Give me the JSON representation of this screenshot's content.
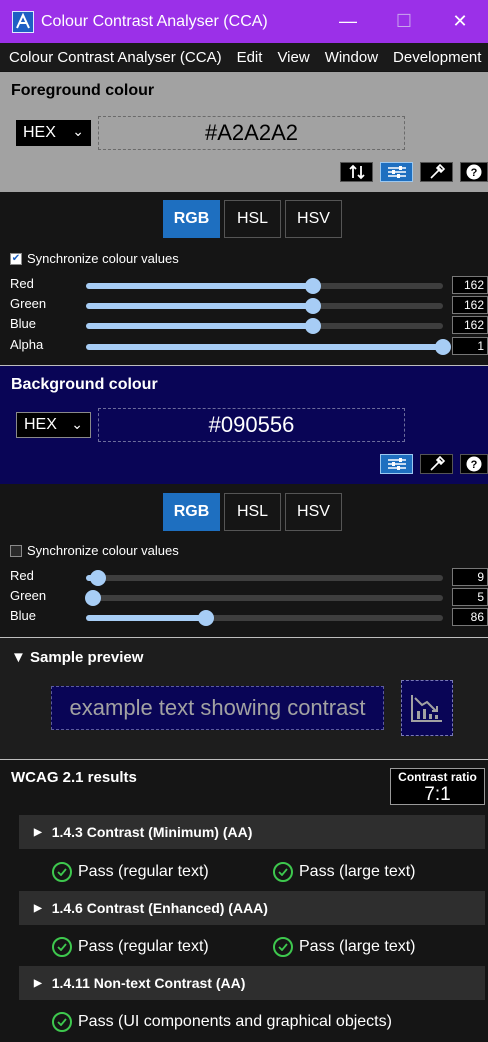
{
  "window": {
    "title": "Colour Contrast Analyser (CCA)",
    "minimize": "—",
    "maximize": "☐",
    "close": "✕"
  },
  "menu": [
    "Colour Contrast Analyser (CCA)",
    "Edit",
    "View",
    "Window",
    "Development"
  ],
  "foreground": {
    "heading": "Foreground colour",
    "format": "HEX",
    "value": "#A2A2A2",
    "colour": "#a2a2a2",
    "tools": [
      "swap-icon",
      "sliders-icon",
      "eyedropper-icon",
      "help-icon"
    ]
  },
  "fg_mode": {
    "tabs": [
      "RGB",
      "HSL",
      "HSV"
    ],
    "selected": "RGB",
    "sync_label": "Synchronize colour values",
    "sync_checked": true,
    "sliders": [
      {
        "label": "Red",
        "value": "162",
        "fraction": 0.635
      },
      {
        "label": "Green",
        "value": "162",
        "fraction": 0.635
      },
      {
        "label": "Blue",
        "value": "162",
        "fraction": 0.635
      },
      {
        "label": "Alpha",
        "value": "1",
        "fraction": 1.0
      }
    ]
  },
  "background": {
    "heading": "Background colour",
    "format": "HEX",
    "value": "#090556",
    "colour": "#090556",
    "tools": [
      "sliders-icon",
      "eyedropper-icon",
      "help-icon"
    ]
  },
  "bg_mode": {
    "tabs": [
      "RGB",
      "HSL",
      "HSV"
    ],
    "selected": "RGB",
    "sync_label": "Synchronize colour values",
    "sync_checked": false,
    "sliders": [
      {
        "label": "Red",
        "value": "9",
        "fraction": 0.035
      },
      {
        "label": "Green",
        "value": "5",
        "fraction": 0.02
      },
      {
        "label": "Blue",
        "value": "86",
        "fraction": 0.337
      }
    ]
  },
  "preview": {
    "heading": "Sample preview",
    "sample_text": "example text showing contrast",
    "icon": "chart-down-icon"
  },
  "results": {
    "heading": "WCAG 2.1 results",
    "ratio_label": "Contrast ratio",
    "ratio_value": "7:1",
    "criteria": [
      {
        "title": "1.4.3 Contrast (Minimum) (AA)",
        "passes": [
          "Pass (regular text)",
          "Pass (large text)"
        ]
      },
      {
        "title": "1.4.6 Contrast (Enhanced) (AAA)",
        "passes": [
          "Pass (regular text)",
          "Pass (large text)"
        ]
      },
      {
        "title": "1.4.11 Non-text Contrast (AA)",
        "passes": [
          "Pass (UI components and graphical objects)"
        ]
      }
    ]
  },
  "colors": {
    "titlebar": "#9b30e8",
    "accent": "#1e6fc0",
    "slider": "#a7cdf5",
    "pass": "#3ec84e"
  }
}
